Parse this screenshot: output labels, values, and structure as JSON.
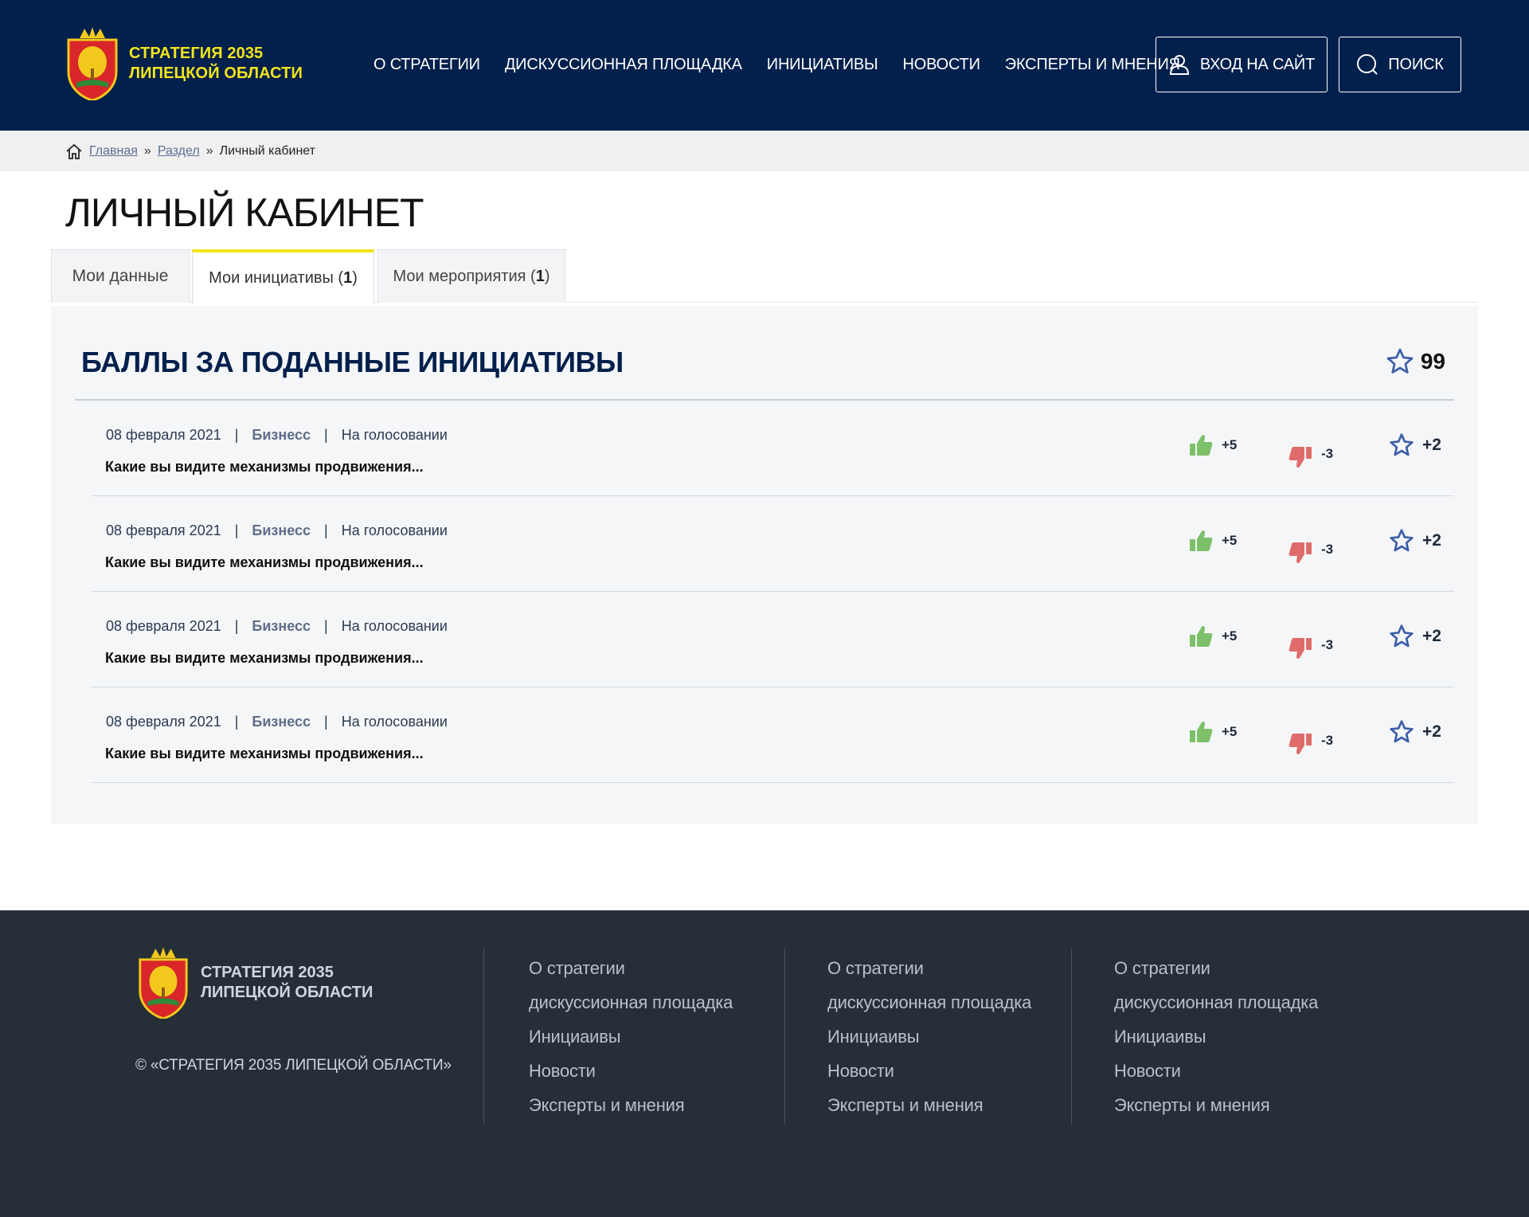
{
  "header": {
    "logo_line1": "СТРАТЕГИЯ 2035",
    "logo_line2": "ЛИПЕЦКОЙ ОБЛАСТИ",
    "nav": [
      "О СТРАТЕГИИ",
      "ДИСКУССИОННАЯ ПЛОЩАДКА",
      "ИНИЦИАТИВЫ",
      "НОВОСТИ",
      "ЭКСПЕРТЫ И МНЕНИЯ"
    ],
    "login_label": "ВХОД НА САЙТ",
    "search_label": "ПОИСК"
  },
  "breadcrumb": {
    "home": "Главная",
    "section": "Раздел",
    "current": "Личный кабинет",
    "separator": "»"
  },
  "page": {
    "title": "ЛИЧНЫЙ КАБИНЕТ"
  },
  "tabs": [
    {
      "label": "Мои данные",
      "count": ""
    },
    {
      "label": "Мои инициативы (",
      "count": "1",
      "close": ")"
    },
    {
      "label": "Мои мероприятия (",
      "count": "1",
      "close": ")"
    }
  ],
  "panel": {
    "title": "БАЛЛЫ ЗА ПОДАННЫЕ ИНИЦИАТИВЫ",
    "total": "99",
    "rows": [
      {
        "date": "08 февраля 2021",
        "category": "Бизнесс",
        "status": "На голосовании",
        "title": "Какие вы видите механизмы продвижения...",
        "likes": "+5",
        "dislikes": "-3",
        "points": "+2"
      },
      {
        "date": "08 февраля 2021",
        "category": "Бизнесс",
        "status": "На голосовании",
        "title": "Какие вы видите механизмы продвижения...",
        "likes": "+5",
        "dislikes": "-3",
        "points": "+2"
      },
      {
        "date": "08 февраля 2021",
        "category": "Бизнесс",
        "status": "На голосовании",
        "title": "Какие вы видите механизмы продвижения...",
        "likes": "+5",
        "dislikes": "-3",
        "points": "+2"
      },
      {
        "date": "08 февраля 2021",
        "category": "Бизнесс",
        "status": "На голосовании",
        "title": "Какие вы видите механизмы продвижения...",
        "likes": "+5",
        "dislikes": "-3",
        "points": "+2"
      }
    ]
  },
  "footer": {
    "logo_line1": "СТРАТЕГИЯ 2035",
    "logo_line2": "ЛИПЕЦКОЙ ОБЛАСТИ",
    "copyright": "© «СТРАТЕГИЯ 2035 ЛИПЕЦКОЙ ОБЛАСТИ»",
    "columns": [
      [
        "О стратегии",
        "дискуссионная площадка",
        "Инициаивы",
        "Новости",
        "Эксперты и мнения"
      ],
      [
        "О стратегии",
        "дискуссионная площадка",
        "Инициаивы",
        "Новости",
        "Эксперты и мнения"
      ],
      [
        "О стратегии",
        "дискуссионная площадка",
        "Инициаивы",
        "Новости",
        "Эксперты и мнения"
      ]
    ]
  },
  "colors": {
    "header_bg": "#02204c",
    "accent_yellow": "#f2e51c",
    "like_green": "#7cc06a",
    "dislike_red": "#e06b6b",
    "star_blue": "#3b5ea8",
    "footer_bg": "#262e38"
  }
}
